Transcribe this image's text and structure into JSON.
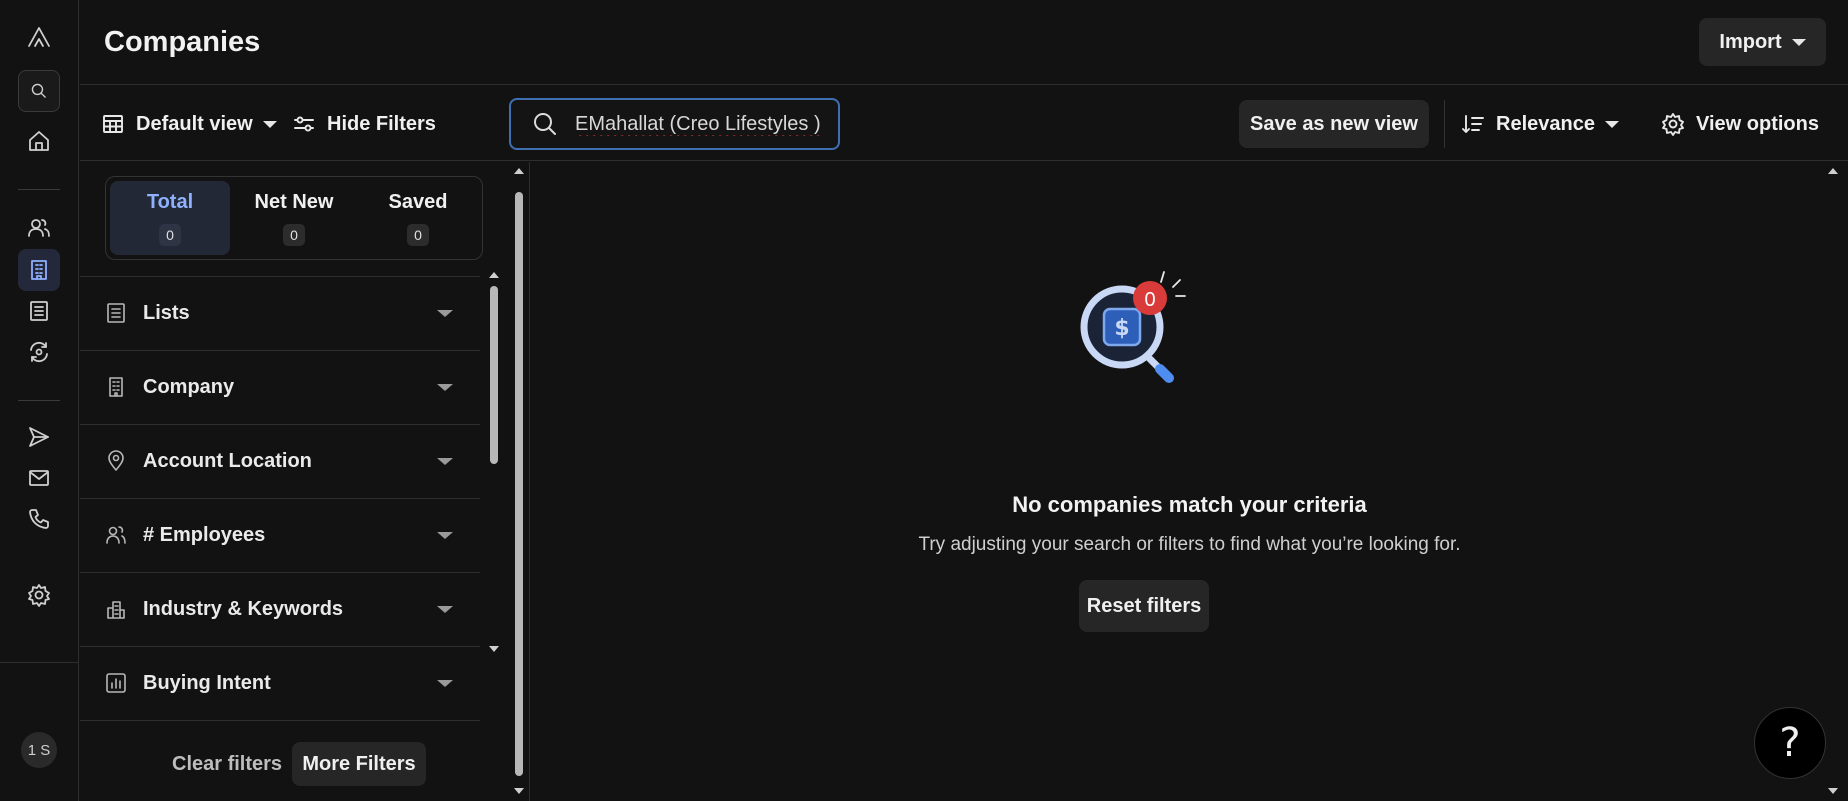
{
  "app": {
    "title": "Companies"
  },
  "rail": {
    "items": [
      {
        "name": "logo-icon"
      },
      {
        "name": "search-icon"
      },
      {
        "name": "home-icon"
      },
      {
        "name": "people-icon"
      },
      {
        "name": "companies-icon",
        "active": true
      },
      {
        "name": "lists-icon"
      },
      {
        "name": "refresh-icon"
      },
      {
        "name": "send-icon"
      },
      {
        "name": "mail-icon"
      },
      {
        "name": "phone-icon"
      },
      {
        "name": "settings-icon"
      }
    ],
    "avatar_initials": "1 S"
  },
  "header": {
    "import_label": "Import"
  },
  "toolbar": {
    "view_label": "Default view",
    "hide_filters_label": "Hide Filters",
    "search_value": "EMahallat (Creo Lifestyles )",
    "save_view_label": "Save as new view",
    "sort_label": "Relevance",
    "view_options_label": "View options"
  },
  "filter_tabs": [
    {
      "label": "Total",
      "count": "0",
      "active": true
    },
    {
      "label": "Net New",
      "count": "0"
    },
    {
      "label": "Saved",
      "count": "0"
    }
  ],
  "filters": [
    {
      "label": "Lists",
      "icon": "list-icon"
    },
    {
      "label": "Company",
      "icon": "building-icon"
    },
    {
      "label": "Account Location",
      "icon": "location-pin-icon"
    },
    {
      "label": "# Employees",
      "icon": "people-icon"
    },
    {
      "label": "Industry & Keywords",
      "icon": "industry-icon"
    },
    {
      "label": "Buying Intent",
      "icon": "bar-chart-icon"
    }
  ],
  "filter_footer": {
    "clear_label": "Clear filters",
    "more_label": "More Filters"
  },
  "empty_state": {
    "badge_count": "0",
    "title": "No companies match your criteria",
    "subtitle": "Try adjusting your search or filters to find what you’re looking for.",
    "reset_label": "Reset filters"
  },
  "help": {
    "label": "?"
  },
  "colors": {
    "background": "#121212",
    "accent": "#8fb0ff",
    "badge": "#d93a3a",
    "search_border": "#3f6fb0"
  }
}
